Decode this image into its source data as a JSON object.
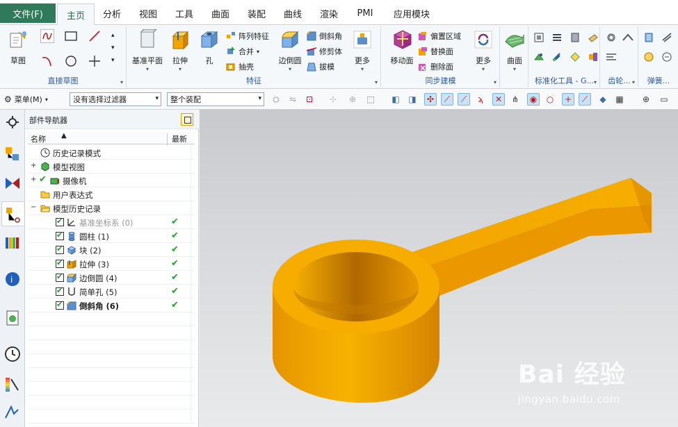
{
  "tabs": {
    "file": "文件(F)",
    "items": [
      "主页",
      "分析",
      "视图",
      "工具",
      "曲面",
      "装配",
      "曲线",
      "渲染",
      "PMI",
      "应用模块"
    ]
  },
  "ribbon": {
    "direct_sketch": {
      "sketch": "草图",
      "title": "直接草图"
    },
    "feature": {
      "datum_plane": "基准平面",
      "extrude": "拉伸",
      "hole": "孔",
      "pattern_feature": "阵列特征",
      "unite": "合并",
      "shell": "抽壳",
      "edge_blend": "边倒圆",
      "chamfer": "倒斜角",
      "trim_body": "修剪体",
      "draft": "拔模",
      "more": "更多",
      "title": "特征"
    },
    "sync": {
      "move_face": "移动面",
      "offset_region": "偏置区域",
      "replace_face": "替换面",
      "delete_face": "删除面",
      "more": "更多",
      "title": "同步建模"
    },
    "surface": {
      "label": "曲面"
    },
    "std_parts": {
      "title": "标准化工具 - G..."
    },
    "gear": {
      "title": "齿轮..."
    },
    "spring": {
      "title": "弹簧..."
    }
  },
  "toolbar": {
    "menu": "菜单(M)",
    "filter": "没有选择过滤器",
    "scope": "整个装配"
  },
  "navigator": {
    "title": "部件导航器",
    "col_name": "名称",
    "col_latest": "最新",
    "rows": [
      {
        "label": "历史记录模式"
      },
      {
        "label": "模型视图"
      },
      {
        "label": "摄像机"
      },
      {
        "label": "用户表达式"
      },
      {
        "label": "模型历史记录"
      }
    ],
    "features": [
      {
        "label": "基准坐标系 (0)"
      },
      {
        "label": "圆柱 (1)"
      },
      {
        "label": "块 (2)"
      },
      {
        "label": "拉伸 (3)"
      },
      {
        "label": "边倒圆 (4)"
      },
      {
        "label": "简单孔 (5)"
      },
      {
        "label": "倒斜角 (6)"
      }
    ]
  },
  "watermark": {
    "main": "Bai 经验",
    "sub": "jingyan.baidu.com"
  },
  "colors": {
    "accent": "#2f7a5a",
    "model": "#f4a800",
    "check": "#1fa32e",
    "group_title": "#2b5a9a"
  }
}
